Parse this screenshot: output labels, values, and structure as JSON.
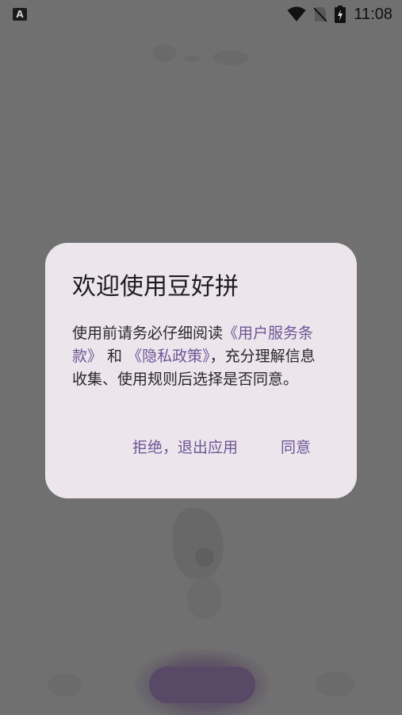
{
  "status_bar": {
    "app_icon_letter": "A",
    "time": "11:08",
    "icons": [
      "wifi-icon",
      "no-sim-icon",
      "battery-charging-icon"
    ]
  },
  "dialog": {
    "title": "欢迎使用豆好拼",
    "body": {
      "prefix": "使用前请务必仔细阅读",
      "link_terms": "《用户服务条款》",
      "and": " 和 ",
      "link_privacy": "《隐私政策》",
      "suffix": "，充分理解信息收集、使用规则后选择是否同意。"
    },
    "reject_label": "拒绝，退出应用",
    "agree_label": "同意"
  },
  "colors": {
    "scrim": "#707070",
    "dialog_bg": "#ece6ec",
    "accent": "#6f5596"
  }
}
